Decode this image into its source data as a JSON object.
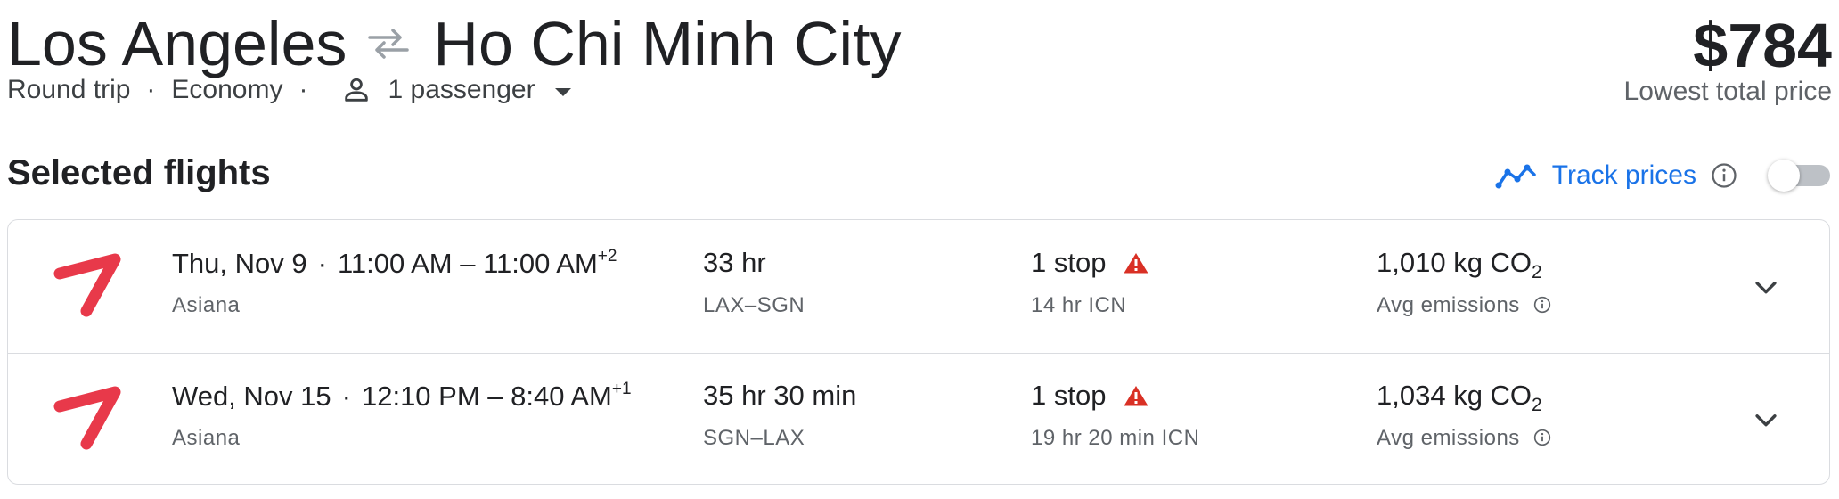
{
  "header": {
    "origin": "Los Angeles",
    "destination": "Ho Chi Minh City",
    "trip_type": "Round trip",
    "cabin": "Economy",
    "passengers": "1 passenger",
    "dot": "·"
  },
  "price": {
    "amount": "$784",
    "label": "Lowest total price"
  },
  "section": {
    "title": "Selected flights",
    "track_label": "Track prices"
  },
  "flights": [
    {
      "date": "Thu, Nov 9",
      "depart": "11:00 AM",
      "arrive": "11:00 AM",
      "day_offset": "+2",
      "airline": "Asiana",
      "duration": "33 hr",
      "route": "LAX–SGN",
      "stops": "1 stop",
      "layover": "14 hr ICN",
      "emissions_value": "1,010 kg CO",
      "emissions_sub": "2",
      "emissions_label": "Avg emissions"
    },
    {
      "date": "Wed, Nov 15",
      "depart": "12:10 PM",
      "arrive": "8:40 AM",
      "day_offset": "+1",
      "airline": "Asiana",
      "duration": "35 hr 30 min",
      "route": "SGN–LAX",
      "stops": "1 stop",
      "layover": "19 hr 20 min ICN",
      "emissions_value": "1,034 kg CO",
      "emissions_sub": "2",
      "emissions_label": "Avg emissions"
    }
  ],
  "colors": {
    "accent": "#1a73e8",
    "airline_logo": "#e8394a",
    "warning": "#d93025"
  },
  "icons": [
    "swap-arrows-icon",
    "person-icon",
    "caret-down-icon",
    "trend-line-icon",
    "info-icon",
    "airline-logo-icon",
    "warning-icon",
    "chevron-down-icon"
  ]
}
